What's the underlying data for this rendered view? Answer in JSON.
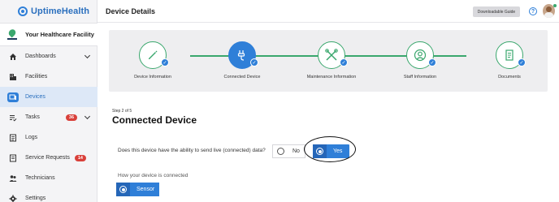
{
  "brand": {
    "name": "UptimeHealth"
  },
  "facility": {
    "name": "Your Healthcare Facility"
  },
  "sidebar": {
    "items": [
      {
        "label": "Dashboards",
        "icon": "home-icon",
        "chevron": true
      },
      {
        "label": "Facilities",
        "icon": "building-icon"
      },
      {
        "label": "Devices",
        "icon": "device-icon",
        "active": true
      },
      {
        "label": "Tasks",
        "icon": "tasks-icon",
        "badge": "36",
        "chevron": true
      },
      {
        "label": "Logs",
        "icon": "logs-icon"
      },
      {
        "label": "Service Requests",
        "icon": "service-requests-icon",
        "badge": "14"
      },
      {
        "label": "Technicians",
        "icon": "technicians-icon"
      },
      {
        "label": "Settings",
        "icon": "settings-icon"
      }
    ]
  },
  "header": {
    "title": "Device Details",
    "guide_button": "Downloadable Guide",
    "help_icon": "?"
  },
  "stepper": {
    "steps": [
      {
        "label": "Device Information",
        "icon": "pencil-icon",
        "state": "done"
      },
      {
        "label": "Connected Device",
        "icon": "plug-icon",
        "state": "current"
      },
      {
        "label": "Maintenance Information",
        "icon": "tools-icon",
        "state": "done"
      },
      {
        "label": "Staff Information",
        "icon": "staff-icon",
        "state": "done"
      },
      {
        "label": "Documents",
        "icon": "document-icon",
        "state": "done"
      }
    ]
  },
  "form": {
    "step_count": "Step 2 of 5",
    "title": "Connected Device",
    "question": "Does this device have the ability to send live (connected) data?",
    "option_no": "No",
    "option_yes": "Yes",
    "selected": "Yes",
    "connection_label": "How your device is connected",
    "connection_option": "Sensor"
  },
  "colors": {
    "accent": "#2f7fd8",
    "success": "#3aa76d",
    "badge": "#d9403a"
  }
}
